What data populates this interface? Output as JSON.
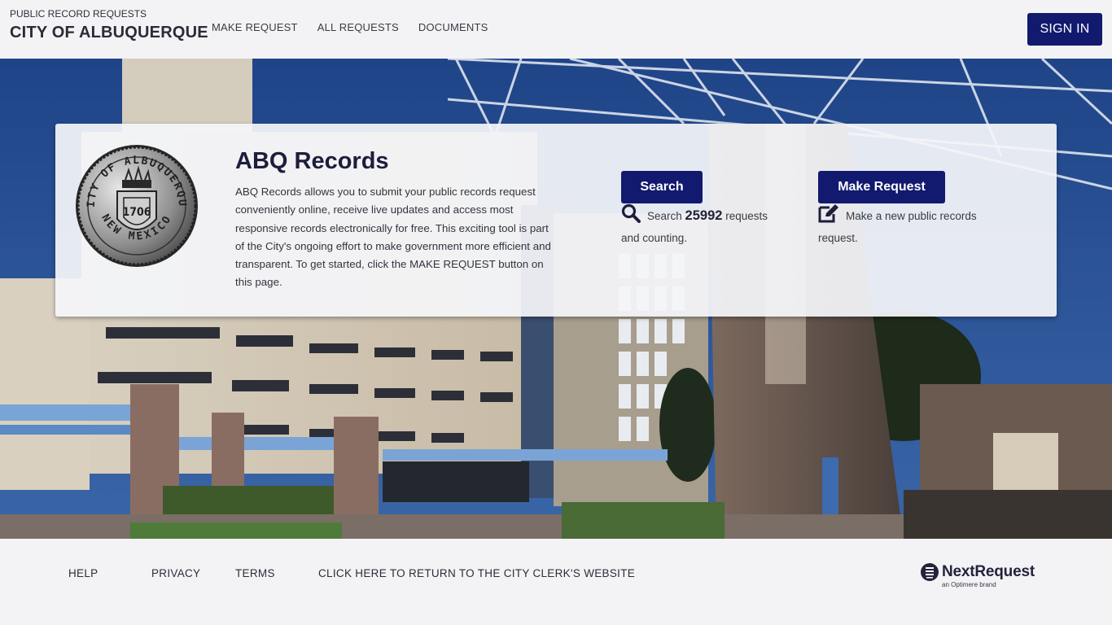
{
  "header": {
    "subtitle": "PUBLIC RECORD REQUESTS",
    "title": "CITY OF ALBUQUERQUE",
    "nav": [
      {
        "label": "MAKE REQUEST"
      },
      {
        "label": "ALL REQUESTS"
      },
      {
        "label": "DOCUMENTS"
      }
    ],
    "sign_in_label": "SIGN IN"
  },
  "hero": {
    "background_description": "Albuquerque city hall plaza photo",
    "card": {
      "seal": {
        "top_text": "CITY OF ALBUQUERQUE",
        "bottom_text": "NEW MEXICO",
        "year": "1706"
      },
      "title": "ABQ Records",
      "description": "ABQ Records allows you to submit your public records request conveniently online, receive live updates and access most responsive records electronically for free. This exciting tool is part of the City's ongoing effort to make government more efficient and transparent. To get started, click the MAKE REQUEST button on this page.",
      "search": {
        "button_label": "Search",
        "icon": "search-icon",
        "text_prefix": "Search",
        "count": "25992",
        "text_suffix": "requests and counting."
      },
      "make_request": {
        "button_label": "Make Request",
        "icon": "edit-icon",
        "text": "Make a new public records request."
      }
    }
  },
  "footer": {
    "links": [
      {
        "label": "HELP"
      },
      {
        "label": "PRIVACY"
      },
      {
        "label": "TERMS"
      },
      {
        "label": "CLICK HERE TO RETURN TO THE CITY CLERK'S WEBSITE"
      }
    ],
    "brand": {
      "name": "NextRequest",
      "tagline": "an Optimere brand"
    }
  },
  "colors": {
    "primary": "#111a6e",
    "background": "#f3f3f6",
    "text_dark": "#1d1d3c"
  }
}
